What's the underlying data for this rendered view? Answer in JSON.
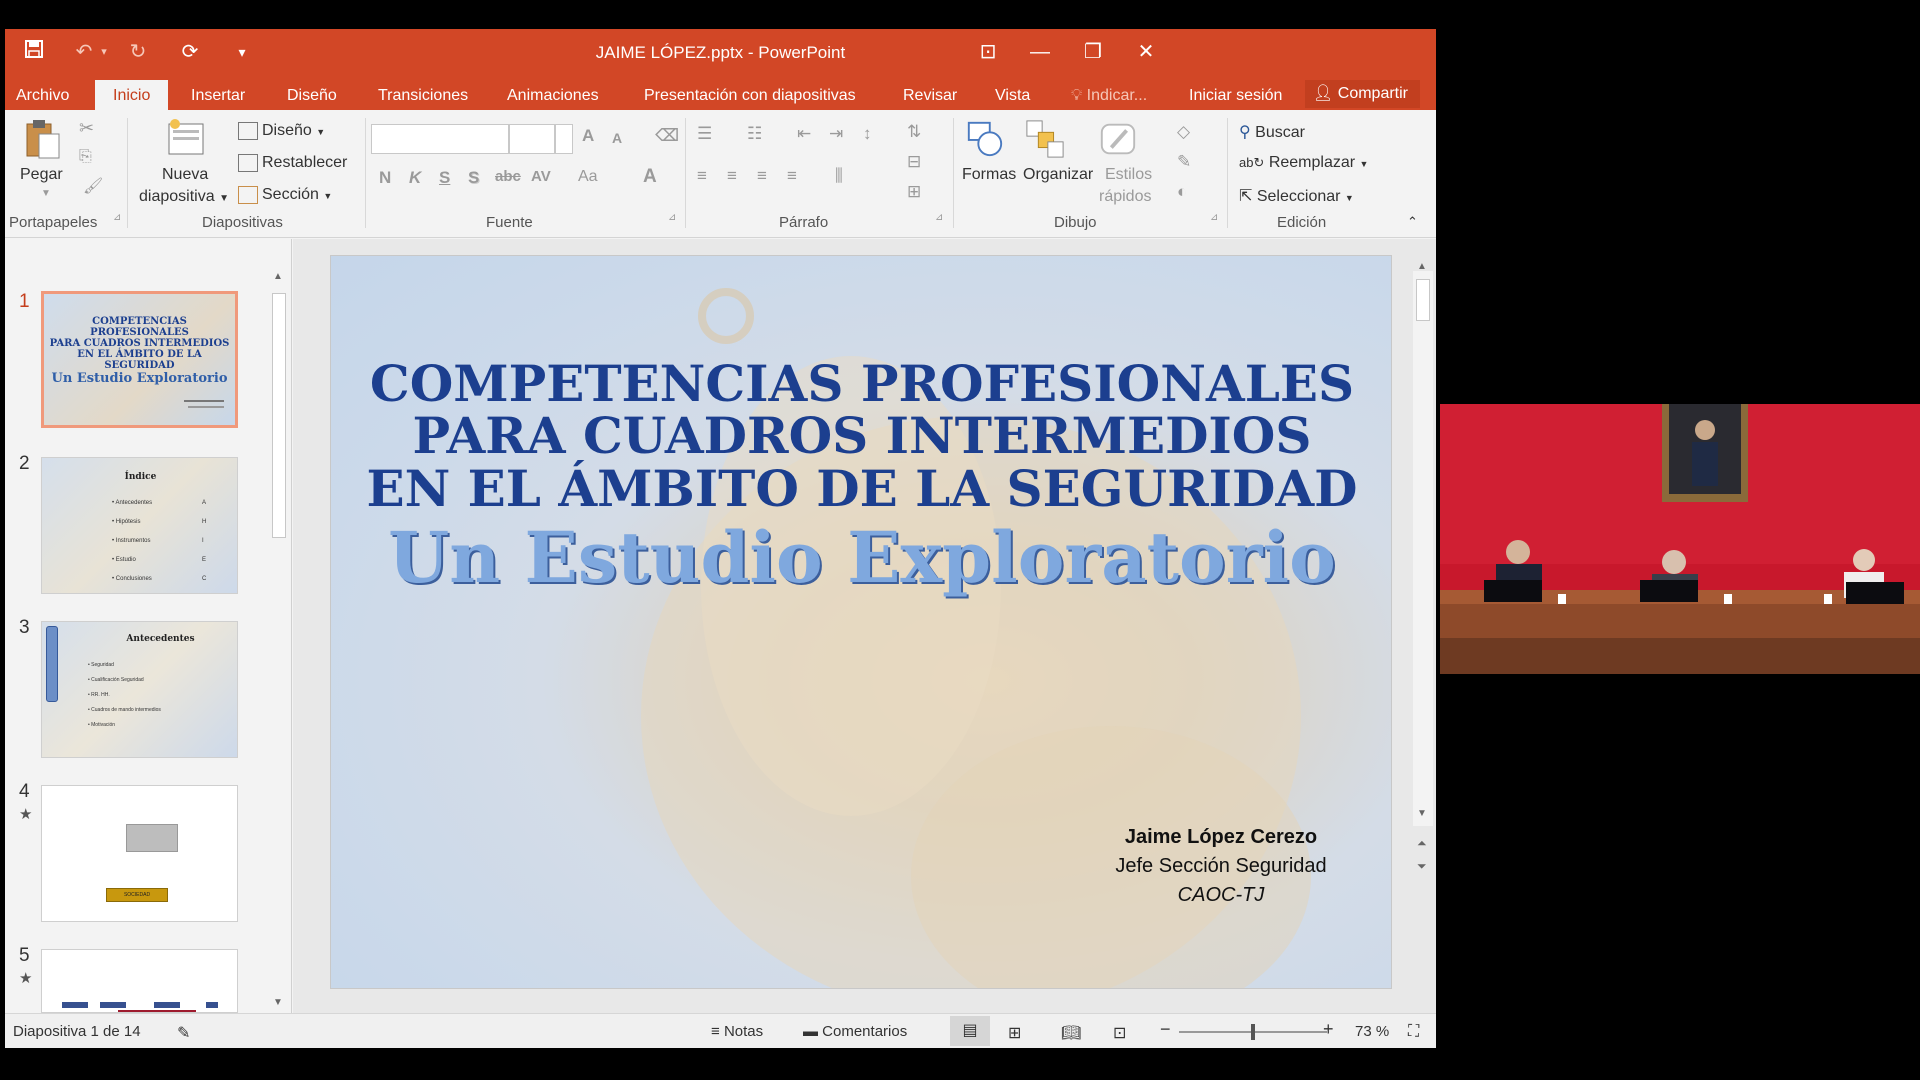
{
  "window": {
    "title": "JAIME LÓPEZ.pptx - PowerPoint",
    "minimize_label": "—",
    "restore_label": "❐",
    "close_label": "✕",
    "ribbon_display_label": "⊡"
  },
  "quick_access": {
    "save": "💾",
    "undo": "↶",
    "redo": "↻",
    "present": "⟳",
    "customize": "▾"
  },
  "tabs": [
    {
      "label": "Archivo"
    },
    {
      "label": "Inicio"
    },
    {
      "label": "Insertar"
    },
    {
      "label": "Diseño"
    },
    {
      "label": "Transiciones"
    },
    {
      "label": "Animaciones"
    },
    {
      "label": "Presentación con diapositivas"
    },
    {
      "label": "Revisar"
    },
    {
      "label": "Vista"
    },
    {
      "label": "Indicar..."
    },
    {
      "label": "Iniciar sesión"
    },
    {
      "label": "Compartir"
    }
  ],
  "ribbon": {
    "portapapeles": {
      "label": "Portapapeles",
      "paste": "Pegar"
    },
    "diapositivas": {
      "label": "Diapositivas",
      "new_slide_line1": "Nueva",
      "new_slide_line2": "diapositiva",
      "layout": "Diseño",
      "reset": "Restablecer",
      "section": "Sección"
    },
    "fuente": {
      "label": "Fuente",
      "bold": "N",
      "italic": "K",
      "underline": "S",
      "shadow": "S",
      "strike": "abc",
      "spacing": "AV",
      "case": "Aa",
      "color": "A",
      "grow": "A",
      "shrink": "A"
    },
    "parrafo": {
      "label": "Párrafo"
    },
    "dibujo": {
      "label": "Dibujo",
      "shapes": "Formas",
      "arrange": "Organizar",
      "quick_styles_line1": "Estilos",
      "quick_styles_line2": "rápidos"
    },
    "edicion": {
      "label": "Edición",
      "find": "Buscar",
      "replace": "Reemplazar",
      "select": "Seleccionar"
    }
  },
  "thumbnails": [
    {
      "num": "1",
      "title1": "COMPETENCIAS PROFESIONALES",
      "title2": "PARA CUADROS INTERMEDIOS",
      "title3": "EN EL ÁMBITO DE LA SEGURIDAD",
      "subtitle": "Un Estudio Exploratorio"
    },
    {
      "num": "2",
      "title": "Índice",
      "items": [
        "Antecedentes",
        "Hipótesis",
        "Instrumentos",
        "Estudio",
        "Conclusiones"
      ],
      "values": [
        "A",
        "H",
        "I",
        "E",
        "C"
      ]
    },
    {
      "num": "3",
      "title": "Antecedentes",
      "items": [
        "Seguridad",
        "Cualificación Seguridad",
        "RR. HH.",
        "Cuadros de mando intermedios",
        "Motivación"
      ]
    },
    {
      "num": "4",
      "star": "★",
      "box": "SOCIEDAD"
    },
    {
      "num": "5",
      "star": "★"
    }
  ],
  "slide": {
    "title_line1": "COMPETENCIAS PROFESIONALES",
    "title_line2": "PARA CUADROS INTERMEDIOS",
    "title_line3": "EN EL ÁMBITO DE LA SEGURIDAD",
    "subtitle": "Un Estudio Exploratorio",
    "author_name": "Jaime López Cerezo",
    "author_role": "Jefe Sección Seguridad",
    "author_org": "CAOC-TJ"
  },
  "statusbar": {
    "slide_counter": "Diapositiva 1 de 14",
    "notes": "Notas",
    "comments": "Comentarios",
    "zoom": "73 %",
    "zoom_fraction": 0.5
  },
  "colors": {
    "titlebar": "#d24726",
    "slide_title": "#1c3f8f",
    "video_wall": "#c8182c"
  }
}
